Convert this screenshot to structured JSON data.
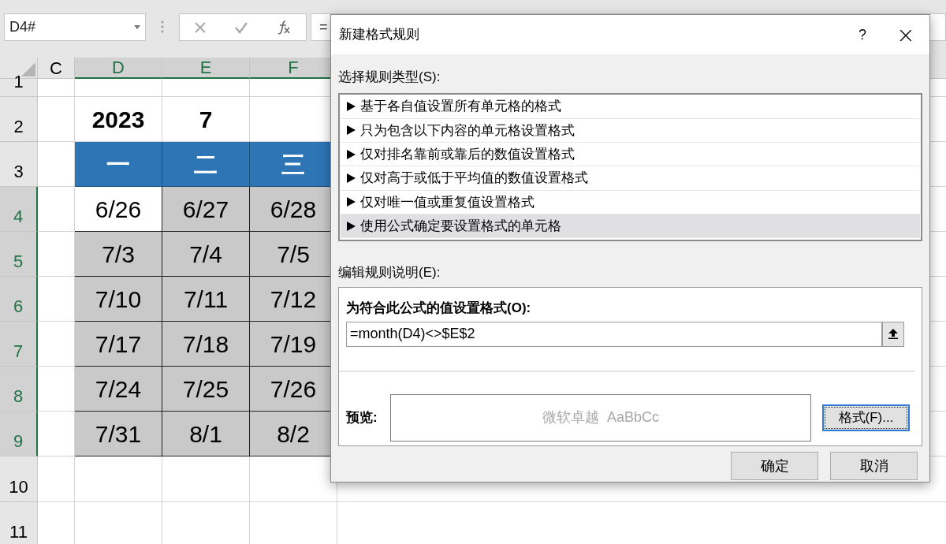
{
  "name_box": "D4#",
  "formula_bar": {
    "text": "="
  },
  "columns": [
    {
      "label": "C",
      "selected": false
    },
    {
      "label": "D",
      "selected": true
    },
    {
      "label": "E",
      "selected": true
    },
    {
      "label": "F",
      "selected": true
    }
  ],
  "rows": [
    {
      "label": "1",
      "selected": false
    },
    {
      "label": "2",
      "selected": false
    },
    {
      "label": "3",
      "selected": false
    },
    {
      "label": "4",
      "selected": true
    },
    {
      "label": "5",
      "selected": true
    },
    {
      "label": "6",
      "selected": true
    },
    {
      "label": "7",
      "selected": true
    },
    {
      "label": "8",
      "selected": true
    },
    {
      "label": "9",
      "selected": true
    },
    {
      "label": "10",
      "selected": false
    },
    {
      "label": "11",
      "selected": false
    }
  ],
  "year": "2023",
  "month": "7",
  "weekdays": [
    "一",
    "二",
    "三"
  ],
  "dates": [
    [
      {
        "text": "6/26",
        "shaded": false
      },
      {
        "text": "6/27",
        "shaded": true
      },
      {
        "text": "6/28",
        "shaded": true
      }
    ],
    [
      {
        "text": "7/3",
        "shaded": true
      },
      {
        "text": "7/4",
        "shaded": true
      },
      {
        "text": "7/5",
        "shaded": true
      }
    ],
    [
      {
        "text": "7/10",
        "shaded": true
      },
      {
        "text": "7/11",
        "shaded": true
      },
      {
        "text": "7/12",
        "shaded": true
      }
    ],
    [
      {
        "text": "7/17",
        "shaded": true
      },
      {
        "text": "7/18",
        "shaded": true
      },
      {
        "text": "7/19",
        "shaded": true
      }
    ],
    [
      {
        "text": "7/24",
        "shaded": true
      },
      {
        "text": "7/25",
        "shaded": true
      },
      {
        "text": "7/26",
        "shaded": true
      }
    ],
    [
      {
        "text": "7/31",
        "shaded": true
      },
      {
        "text": "8/1",
        "shaded": true
      },
      {
        "text": "8/2",
        "shaded": true
      }
    ]
  ],
  "dialog": {
    "title": "新建格式规则",
    "help": "?",
    "close": "×",
    "rule_type_label": "选择规则类型(S):",
    "rule_types": [
      {
        "label": "基于各自值设置所有单元格的格式",
        "selected": false
      },
      {
        "label": "只为包含以下内容的单元格设置格式",
        "selected": false
      },
      {
        "label": "仅对排名靠前或靠后的数值设置格式",
        "selected": false
      },
      {
        "label": "仅对高于或低于平均值的数值设置格式",
        "selected": false
      },
      {
        "label": "仅对唯一值或重复值设置格式",
        "selected": false
      },
      {
        "label": "使用公式确定要设置格式的单元格",
        "selected": true
      }
    ],
    "edit_label": "编辑规则说明(E):",
    "formula_label": "为符合此公式的值设置格式(O):",
    "formula": "=month(D4)<>$E$2",
    "preview_label": "预览:",
    "preview_text": "微软卓越  AaBbCc",
    "format_button": "格式(F)...",
    "ok": "确定",
    "cancel": "取消"
  }
}
